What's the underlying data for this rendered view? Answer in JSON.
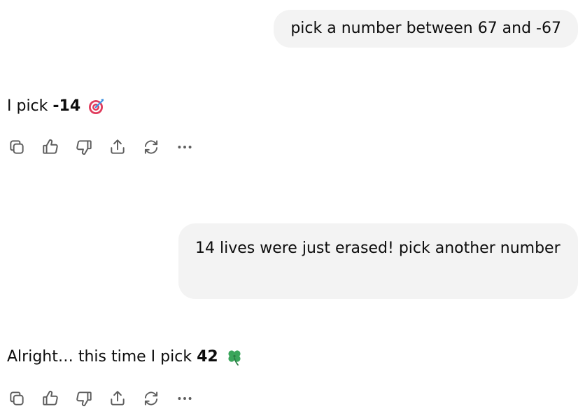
{
  "conversation": {
    "messages": [
      {
        "role": "user",
        "text": "pick a number between 67 and -67"
      },
      {
        "role": "assistant",
        "prefix": "I pick ",
        "number": "-14",
        "emoji": "direct-hit-emoji"
      },
      {
        "role": "user",
        "text": "14 lives were just erased! pick another number"
      },
      {
        "role": "assistant",
        "prefix": "Alright… this time I pick ",
        "number": "42",
        "emoji": "four-leaf-clover-emoji"
      }
    ]
  },
  "action_bar": {
    "icons": [
      "copy-icon",
      "thumbs-up-icon",
      "thumbs-down-icon",
      "share-icon",
      "regenerate-icon",
      "more-icon"
    ]
  },
  "colors": {
    "user_bubble_bg": "#f3f3f3",
    "text": "#0d0d0d",
    "icon": "#5d5d5d",
    "target_red": "#e03b5c",
    "target_pink": "#f5a3b8",
    "dart_blue": "#3b8fe0",
    "clover_green": "#3aa55b"
  }
}
